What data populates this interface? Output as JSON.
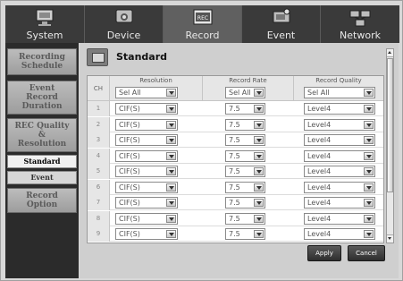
{
  "tabs": [
    {
      "label": "System",
      "icon": "monitor-icon",
      "active": false
    },
    {
      "label": "Device",
      "icon": "camera-icon",
      "active": false
    },
    {
      "label": "Record",
      "icon": "record-icon",
      "active": true,
      "icon_text": "REC"
    },
    {
      "label": "Event",
      "icon": "event-icon",
      "active": false
    },
    {
      "label": "Network",
      "icon": "network-icon",
      "active": false
    }
  ],
  "sidebar": {
    "items": [
      {
        "label": "Recording\nSchedule"
      },
      {
        "label": "Event\nRecord\nDuration"
      },
      {
        "label": "REC Quality\n&\nResolution"
      },
      {
        "label": "Standard",
        "sub": true,
        "selected": true
      },
      {
        "label": "Event",
        "sub": true,
        "selected": false
      },
      {
        "label": "Record\nOption"
      }
    ]
  },
  "main": {
    "title": "Standard",
    "title_icon": "standard-record-icon",
    "headers": {
      "ch": "CH",
      "resolution": "Resolution",
      "record_rate": "Record Rate",
      "record_quality": "Record Quality"
    },
    "header_selects": {
      "resolution": "Sel All",
      "record_rate": "Sel All",
      "record_quality": "Sel All"
    },
    "rows": [
      {
        "ch": "1",
        "resolution": "CIF(S)",
        "rate": "7.5",
        "quality": "Level4"
      },
      {
        "ch": "2",
        "resolution": "CIF(S)",
        "rate": "7.5",
        "quality": "Level4"
      },
      {
        "ch": "3",
        "resolution": "CIF(S)",
        "rate": "7.5",
        "quality": "Level4"
      },
      {
        "ch": "4",
        "resolution": "CIF(S)",
        "rate": "7.5",
        "quality": "Level4"
      },
      {
        "ch": "5",
        "resolution": "CIF(S)",
        "rate": "7.5",
        "quality": "Level4"
      },
      {
        "ch": "6",
        "resolution": "CIF(S)",
        "rate": "7.5",
        "quality": "Level4"
      },
      {
        "ch": "7",
        "resolution": "CIF(S)",
        "rate": "7.5",
        "quality": "Level4"
      },
      {
        "ch": "8",
        "resolution": "CIF(S)",
        "rate": "7.5",
        "quality": "Level4"
      },
      {
        "ch": "9",
        "resolution": "CIF(S)",
        "rate": "7.5",
        "quality": "Level4"
      }
    ],
    "buttons": {
      "apply": "Apply",
      "cancel": "Cancel"
    }
  },
  "colors": {
    "active_tab": "#606060",
    "tab_bar": "#3a3a3a",
    "sidebar_bg": "#2b2b2b",
    "panel_bg": "#cfcfcf"
  }
}
